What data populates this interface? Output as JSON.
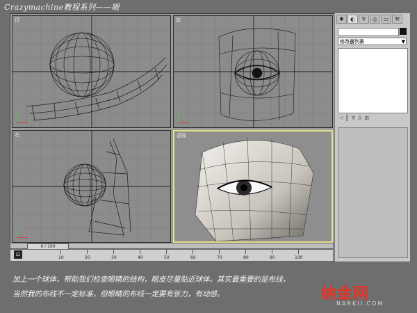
{
  "header": {
    "title": "Crazymachine教程系列——眼"
  },
  "viewports": {
    "top_label": "顶",
    "front_label": "前",
    "left_label": "左",
    "persp_label": "透视"
  },
  "command_panel": {
    "tabs": [
      {
        "icon": "create-icon"
      },
      {
        "icon": "modify-icon"
      },
      {
        "icon": "hierarchy-icon"
      },
      {
        "icon": "motion-icon"
      },
      {
        "icon": "display-icon"
      },
      {
        "icon": "utilities-icon"
      }
    ],
    "modifier_list_label": "修改器列表"
  },
  "timeline": {
    "frame_counter": "0 / 100",
    "ruler_ticks": [
      "10",
      "20",
      "30",
      "40",
      "50",
      "60",
      "70",
      "80",
      "90",
      "100"
    ]
  },
  "caption": {
    "line1": "加上一个球体，帮助我们检查眼睛的结构，眼皮尽量贴近球体。其实最重要的是布线，",
    "line2": "当然我的布线不一定标准，但眼睛的布线一定要有张力，有动感。"
  },
  "watermark": {
    "brand": "纳金网",
    "url": "NARKII.COM"
  },
  "colors": {
    "active_viewport_border": "#e7e08a",
    "logo_red": "#e23424"
  }
}
